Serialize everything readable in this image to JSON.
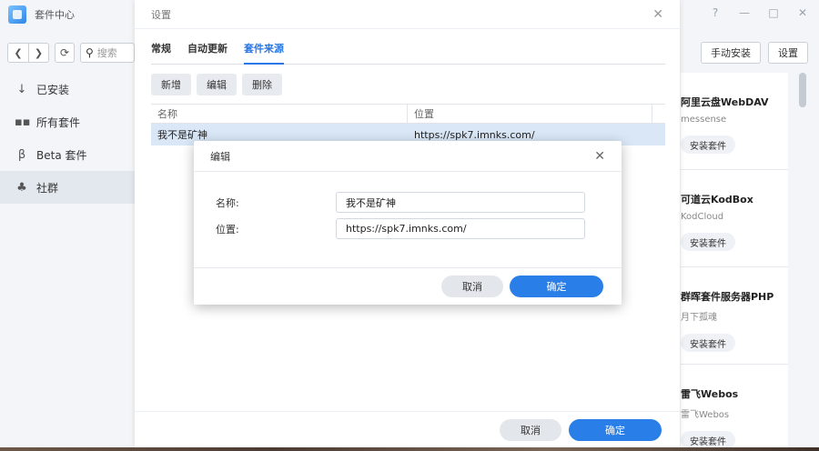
{
  "app": {
    "title": "套件中心",
    "window_controls": [
      "?",
      "—",
      "□",
      "✕"
    ],
    "search_placeholder": "搜索",
    "toolbar_icons": [
      "chevron-left-icon",
      "chevron-right-icon",
      "refresh-icon",
      "search-icon"
    ],
    "sidebar": [
      {
        "icon": "↓",
        "label": "已安装"
      },
      {
        "icon": "▪▪",
        "label": "所有套件"
      },
      {
        "icon": "β",
        "label": "Beta 套件"
      },
      {
        "icon": "♣",
        "label": "社群",
        "active": true
      }
    ],
    "top_buttons": {
      "manual_install": "手动安装",
      "settings": "设置"
    },
    "cards": [
      {
        "title": "阿里云盘WebDAV",
        "subtitle": "messense",
        "button": "安装套件"
      },
      {
        "title": "可道云KodBox",
        "subtitle": "KodCloud",
        "button": "安装套件"
      },
      {
        "title": "群晖套件服务器PHP",
        "subtitle": "月下孤魂",
        "button": "安装套件"
      },
      {
        "title": "雷飞Webos",
        "subtitle": "雷飞Webos",
        "button": "安装套件"
      }
    ]
  },
  "settings": {
    "title": "设置",
    "close": "✕",
    "tabs": [
      "常规",
      "自动更新",
      "套件来源"
    ],
    "active_tab": 2,
    "actions": {
      "add": "新增",
      "edit": "编辑",
      "delete": "删除"
    },
    "grid": {
      "headers": {
        "name": "名称",
        "location": "位置"
      },
      "rows": [
        {
          "name": "我不是矿神",
          "location": "https://spk7.imnks.com/",
          "selected": true
        }
      ]
    },
    "footer": {
      "cancel": "取消",
      "ok": "确定"
    }
  },
  "edit_modal": {
    "title": "编辑",
    "close": "✕",
    "fields": {
      "name": {
        "label": "名称:",
        "value": "我不是矿神"
      },
      "location": {
        "label": "位置:",
        "value": "https://spk7.imnks.com/"
      }
    },
    "cancel": "取消",
    "ok": "确定"
  },
  "colors": {
    "accent": "#2a7ee8",
    "selected_row": "#d9e7f7"
  }
}
